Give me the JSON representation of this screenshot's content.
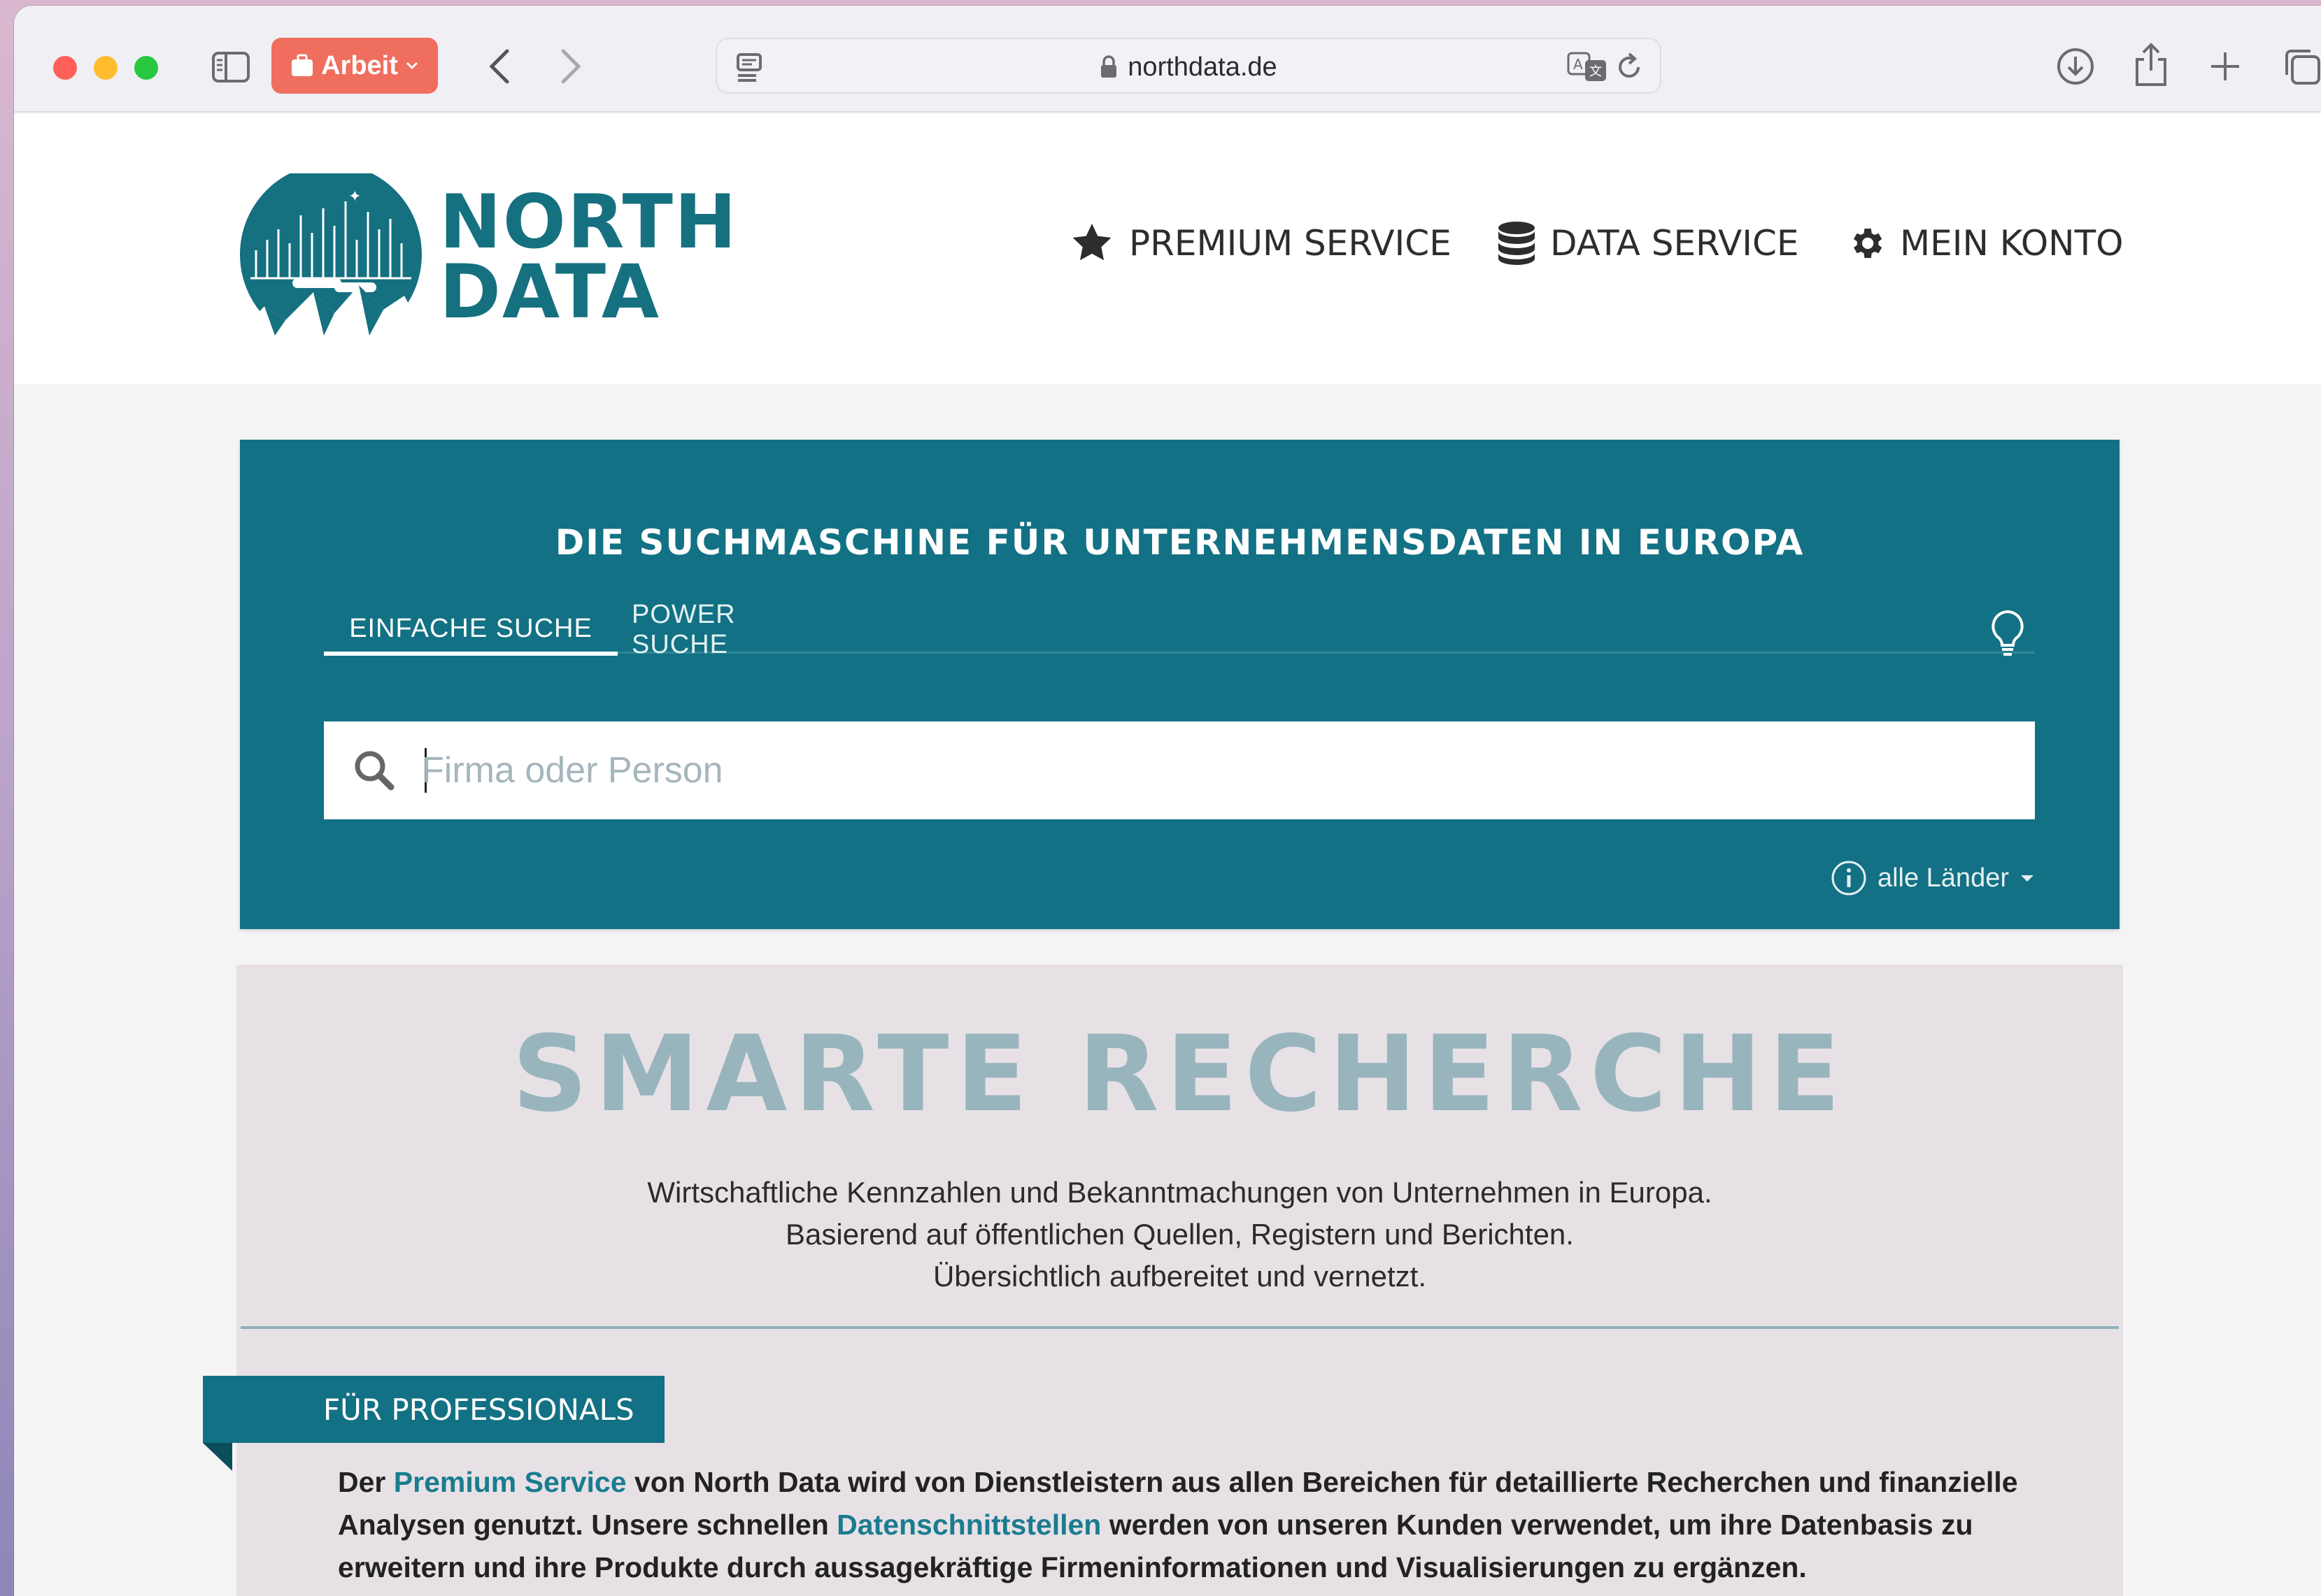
{
  "browser": {
    "profile_label": "Arbeit",
    "url": "northdata.de"
  },
  "header": {
    "logo_line1": "NORTH",
    "logo_line2": "DATA",
    "nav": {
      "premium": "PREMIUM SERVICE",
      "data": "DATA SERVICE",
      "account": "MEIN KONTO"
    }
  },
  "hero": {
    "title": "DIE SUCHMASCHINE FÜR UNTERNEHMENSDATEN IN EUROPA",
    "tabs": {
      "simple": "EINFACHE SUCHE",
      "power": "POWER SUCHE"
    },
    "search": {
      "placeholder": "Firma oder Person",
      "value": ""
    },
    "country_filter": "alle Länder"
  },
  "content": {
    "big_title": "SMARTE RECHERCHE",
    "lines": [
      "Wirtschaftliche Kennzahlen und Bekanntmachungen von Unternehmen in Europa.",
      "Basierend auf öffentlichen Quellen, Registern und Berichten.",
      "Übersichtlich aufbereitet und vernetzt."
    ],
    "ribbon": "FÜR PROFESSIONALS",
    "pro": {
      "t1": "Der ",
      "link1": "Premium Service",
      "t2": " von North Data wird von Dienstleistern aus allen Bereichen für detaillierte Recherchen und finanzielle Analysen genutzt. Unsere schnellen ",
      "link2": "Datenschnittstellen",
      "t3": " werden von unseren Kunden verwendet, um ihre Datenbasis zu erweitern und ihre Produkte durch aussagekräftige Firmeninformationen und Visualisierungen zu ergänzen."
    }
  },
  "colors": {
    "brand_teal": "#127184",
    "title_muted": "#98b5be",
    "link": "#1a7c8f",
    "profile_red": "#ef6e5e"
  }
}
